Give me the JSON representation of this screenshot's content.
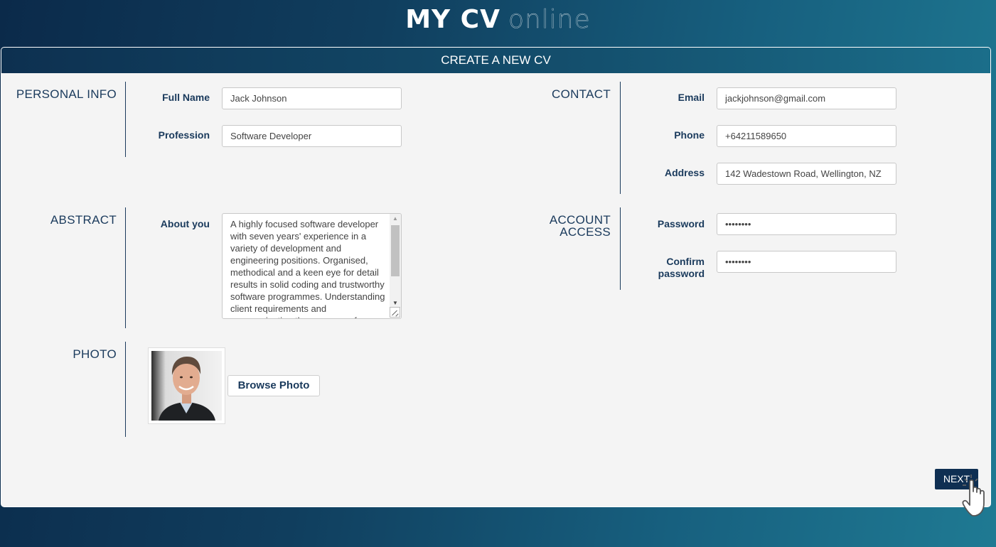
{
  "app": {
    "logo_bold": "MY CV",
    "logo_thin": "online"
  },
  "form": {
    "header": "CREATE A NEW CV",
    "sections": {
      "personal_info": "PERSONAL INFO",
      "contact": "CONTACT",
      "abstract": "ABSTRACT",
      "account_access_1": "ACCOUNT",
      "account_access_2": "ACCESS",
      "photo": "PHOTO"
    },
    "fields": {
      "full_name": {
        "label": "Full Name",
        "value": "Jack Johnson"
      },
      "profession": {
        "label": "Profession",
        "value": "Software Developer"
      },
      "email": {
        "label": "Email",
        "value": "jackjohnson@gmail.com"
      },
      "phone": {
        "label": "Phone",
        "value": "+64211589650"
      },
      "address": {
        "label": "Address",
        "value": "142 Wadestown Road, Wellington, NZ"
      },
      "about": {
        "label": "About you",
        "value": "A highly focused software developer with seven years' experience in a variety of development and engineering positions. Organised, methodical and a keen eye for detail results in solid coding and trustworthy software programmes. Understanding client requirements and communicating the progress of"
      },
      "password": {
        "label": "Password",
        "value": "••••••••"
      },
      "confirm_password": {
        "label_1": "Confirm",
        "label_2": "password",
        "value": "••••••••"
      }
    },
    "browse_photo_label": "Browse Photo",
    "next_label": "NEXT"
  },
  "icons": {
    "cursor": "hand-pointer-icon"
  },
  "colors": {
    "navy": "#1a3a5c",
    "header_dark": "#0d3050",
    "next_button": "#0f2f52",
    "panel_bg": "#f4f4f4"
  }
}
